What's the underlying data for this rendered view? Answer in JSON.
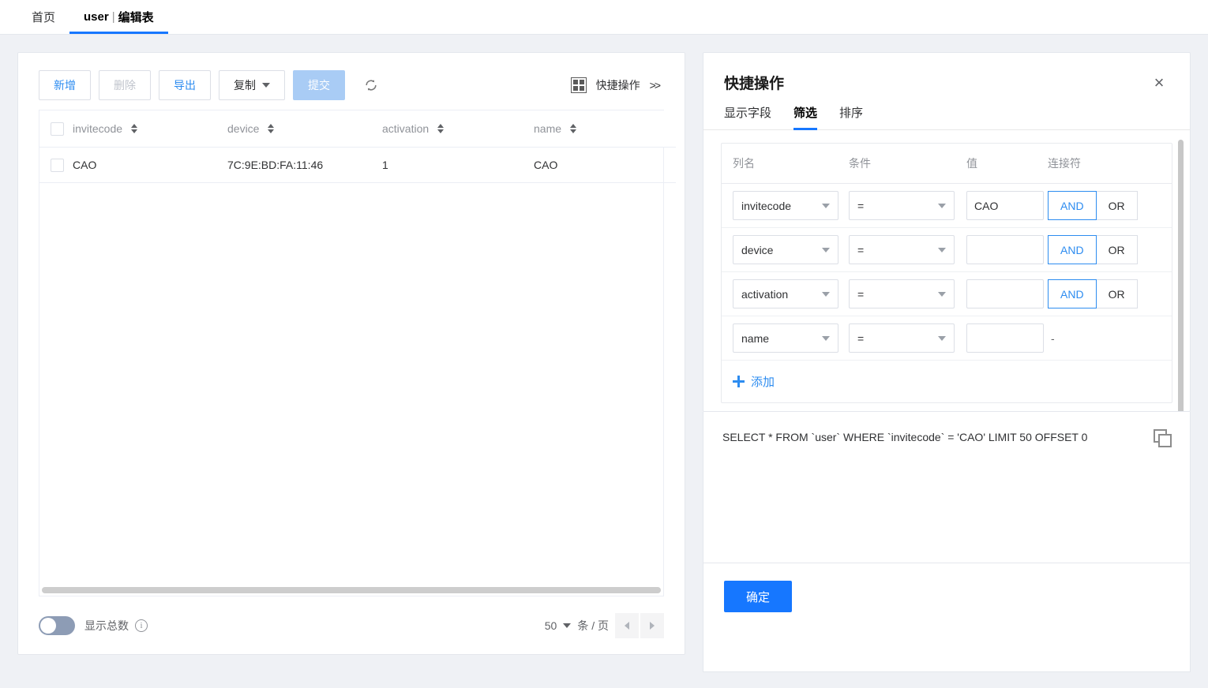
{
  "topbar": {
    "tabs": [
      {
        "label": "首页",
        "active": false
      },
      {
        "label": "user",
        "separator": "|",
        "label2": "编辑表",
        "active": true
      }
    ]
  },
  "toolbar": {
    "add_label": "新增",
    "delete_label": "删除",
    "export_label": "导出",
    "copy_label": "复制",
    "submit_label": "提交",
    "refresh_icon": "refresh-icon",
    "grid_icon": "grid-icon",
    "quick_ops_label": "快捷操作",
    "quick_ops_chevrons": ">>"
  },
  "table": {
    "columns": [
      "invitecode",
      "device",
      "activation",
      "name"
    ],
    "rows": [
      {
        "invitecode": "CAO",
        "device": "7C:9E:BD:FA:11:46",
        "activation": "1",
        "name": "CAO"
      }
    ]
  },
  "pagination": {
    "show_total_label": "显示总数",
    "show_total_on": false,
    "page_size": "50",
    "page_size_unit": "条 / 页",
    "prev_label": "prev-page",
    "next_label": "next-page"
  },
  "right_panel": {
    "title": "快捷操作",
    "close_label": "×",
    "tabs": [
      {
        "label": "显示字段",
        "active": false
      },
      {
        "label": "筛选",
        "active": true
      },
      {
        "label": "排序",
        "active": false
      }
    ],
    "filter": {
      "headers": [
        "列名",
        "条件",
        "值",
        "连接符"
      ],
      "rows": [
        {
          "column": "invitecode",
          "operator": "=",
          "value": "CAO",
          "connector": "AND",
          "connector_options": [
            "AND",
            "OR"
          ]
        },
        {
          "column": "device",
          "operator": "=",
          "value": "",
          "connector": "AND",
          "connector_options": [
            "AND",
            "OR"
          ]
        },
        {
          "column": "activation",
          "operator": "=",
          "value": "",
          "connector": "AND",
          "connector_options": [
            "AND",
            "OR"
          ]
        },
        {
          "column": "name",
          "operator": "=",
          "value": "",
          "connector": "-",
          "connector_options": []
        }
      ],
      "add_label": "添加"
    },
    "sql": "SELECT * FROM `user` WHERE `invitecode` = 'CAO' LIMIT 50 OFFSET 0",
    "copy_icon": "copy-icon",
    "confirm_label": "确定"
  },
  "colors": {
    "accent": "#1677ff",
    "link": "#2d8cf0",
    "page_bg": "#eff1f5",
    "panel_bg": "#ffffff",
    "border": "#e4e7ed",
    "muted_text": "#909399",
    "disabled_text": "#c0c4cc",
    "submit_soft": "#a9ccf5"
  }
}
